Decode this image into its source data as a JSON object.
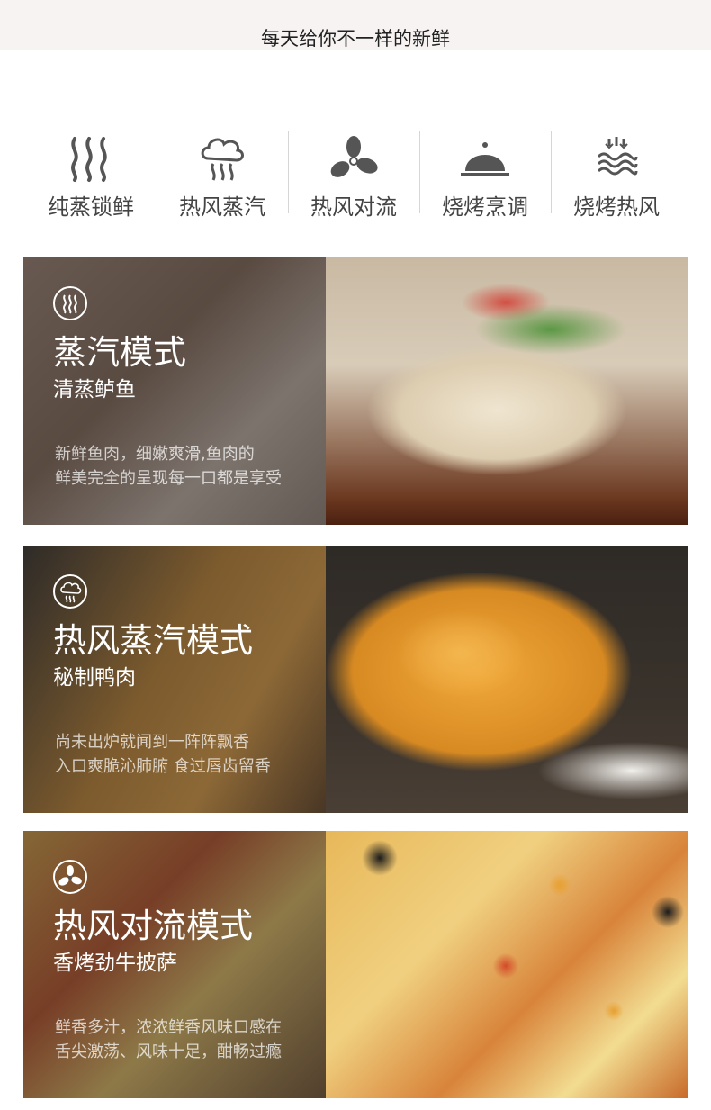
{
  "header": {
    "title": "每天给你不一样的新鲜"
  },
  "features": [
    {
      "label": "纯蒸锁鲜",
      "icon": "steam-lines-icon"
    },
    {
      "label": "热风蒸汽",
      "icon": "steam-cloud-icon"
    },
    {
      "label": "热风对流",
      "icon": "fan-icon"
    },
    {
      "label": "烧烤烹调",
      "icon": "cloche-icon"
    },
    {
      "label": "烧烤热风",
      "icon": "heat-waves-icon"
    }
  ],
  "cards": [
    {
      "mode": "蒸汽模式",
      "dish": "清蒸鲈鱼",
      "desc": [
        "新鲜鱼肉，细嫩爽滑,鱼肉的",
        "鲜美完全的呈现每一口都是享受"
      ],
      "icon": "steam-lines-icon"
    },
    {
      "mode": "热风蒸汽模式",
      "dish": "秘制鸭肉",
      "desc": [
        "尚未出炉就闻到一阵阵飘香",
        "入口爽脆沁肺腑 食过唇齿留香"
      ],
      "icon": "steam-cloud-icon"
    },
    {
      "mode": "热风对流模式",
      "dish": "香烤劲牛披萨",
      "desc": [
        "鲜香多汁，浓浓鲜香风味口感在",
        "舌尖激荡、风味十足，酣畅过瘾"
      ],
      "icon": "fan-icon"
    }
  ]
}
